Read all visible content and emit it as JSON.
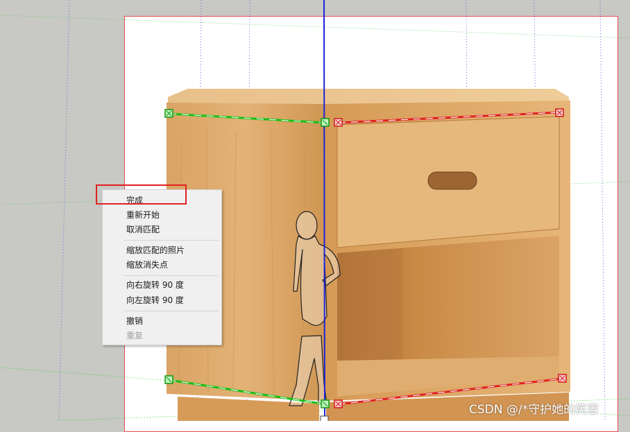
{
  "context_menu": {
    "items": [
      {
        "label": "完成",
        "enabled": true
      },
      {
        "label": "重新开始",
        "enabled": true
      },
      {
        "label": "取消匹配",
        "enabled": true
      },
      {
        "label": "缩放匹配的照片",
        "enabled": true
      },
      {
        "label": "缩放消失点",
        "enabled": true
      },
      {
        "label": "向右旋转 90 度",
        "enabled": true
      },
      {
        "label": "向左旋转 90 度",
        "enabled": true
      },
      {
        "label": "撤销",
        "enabled": true
      },
      {
        "label": "重复",
        "enabled": false
      }
    ]
  },
  "watermark": "CSDN @/*守护她的笑容",
  "colors": {
    "viewport_bg": "#c8c8c4",
    "frame_border": "#e0504f",
    "vertical_axis": "#1b24d9",
    "left_axis": "#1fcf1f",
    "right_axis": "#e02020",
    "highlight": "#e02020",
    "wood_light": "#e3b276",
    "wood_mid": "#d39a5a",
    "wood_dark": "#a86d35"
  },
  "icons": {
    "green_grip": "green-square-grip-icon",
    "red_grip": "red-square-grip-icon",
    "person": "scale-figure-icon"
  }
}
